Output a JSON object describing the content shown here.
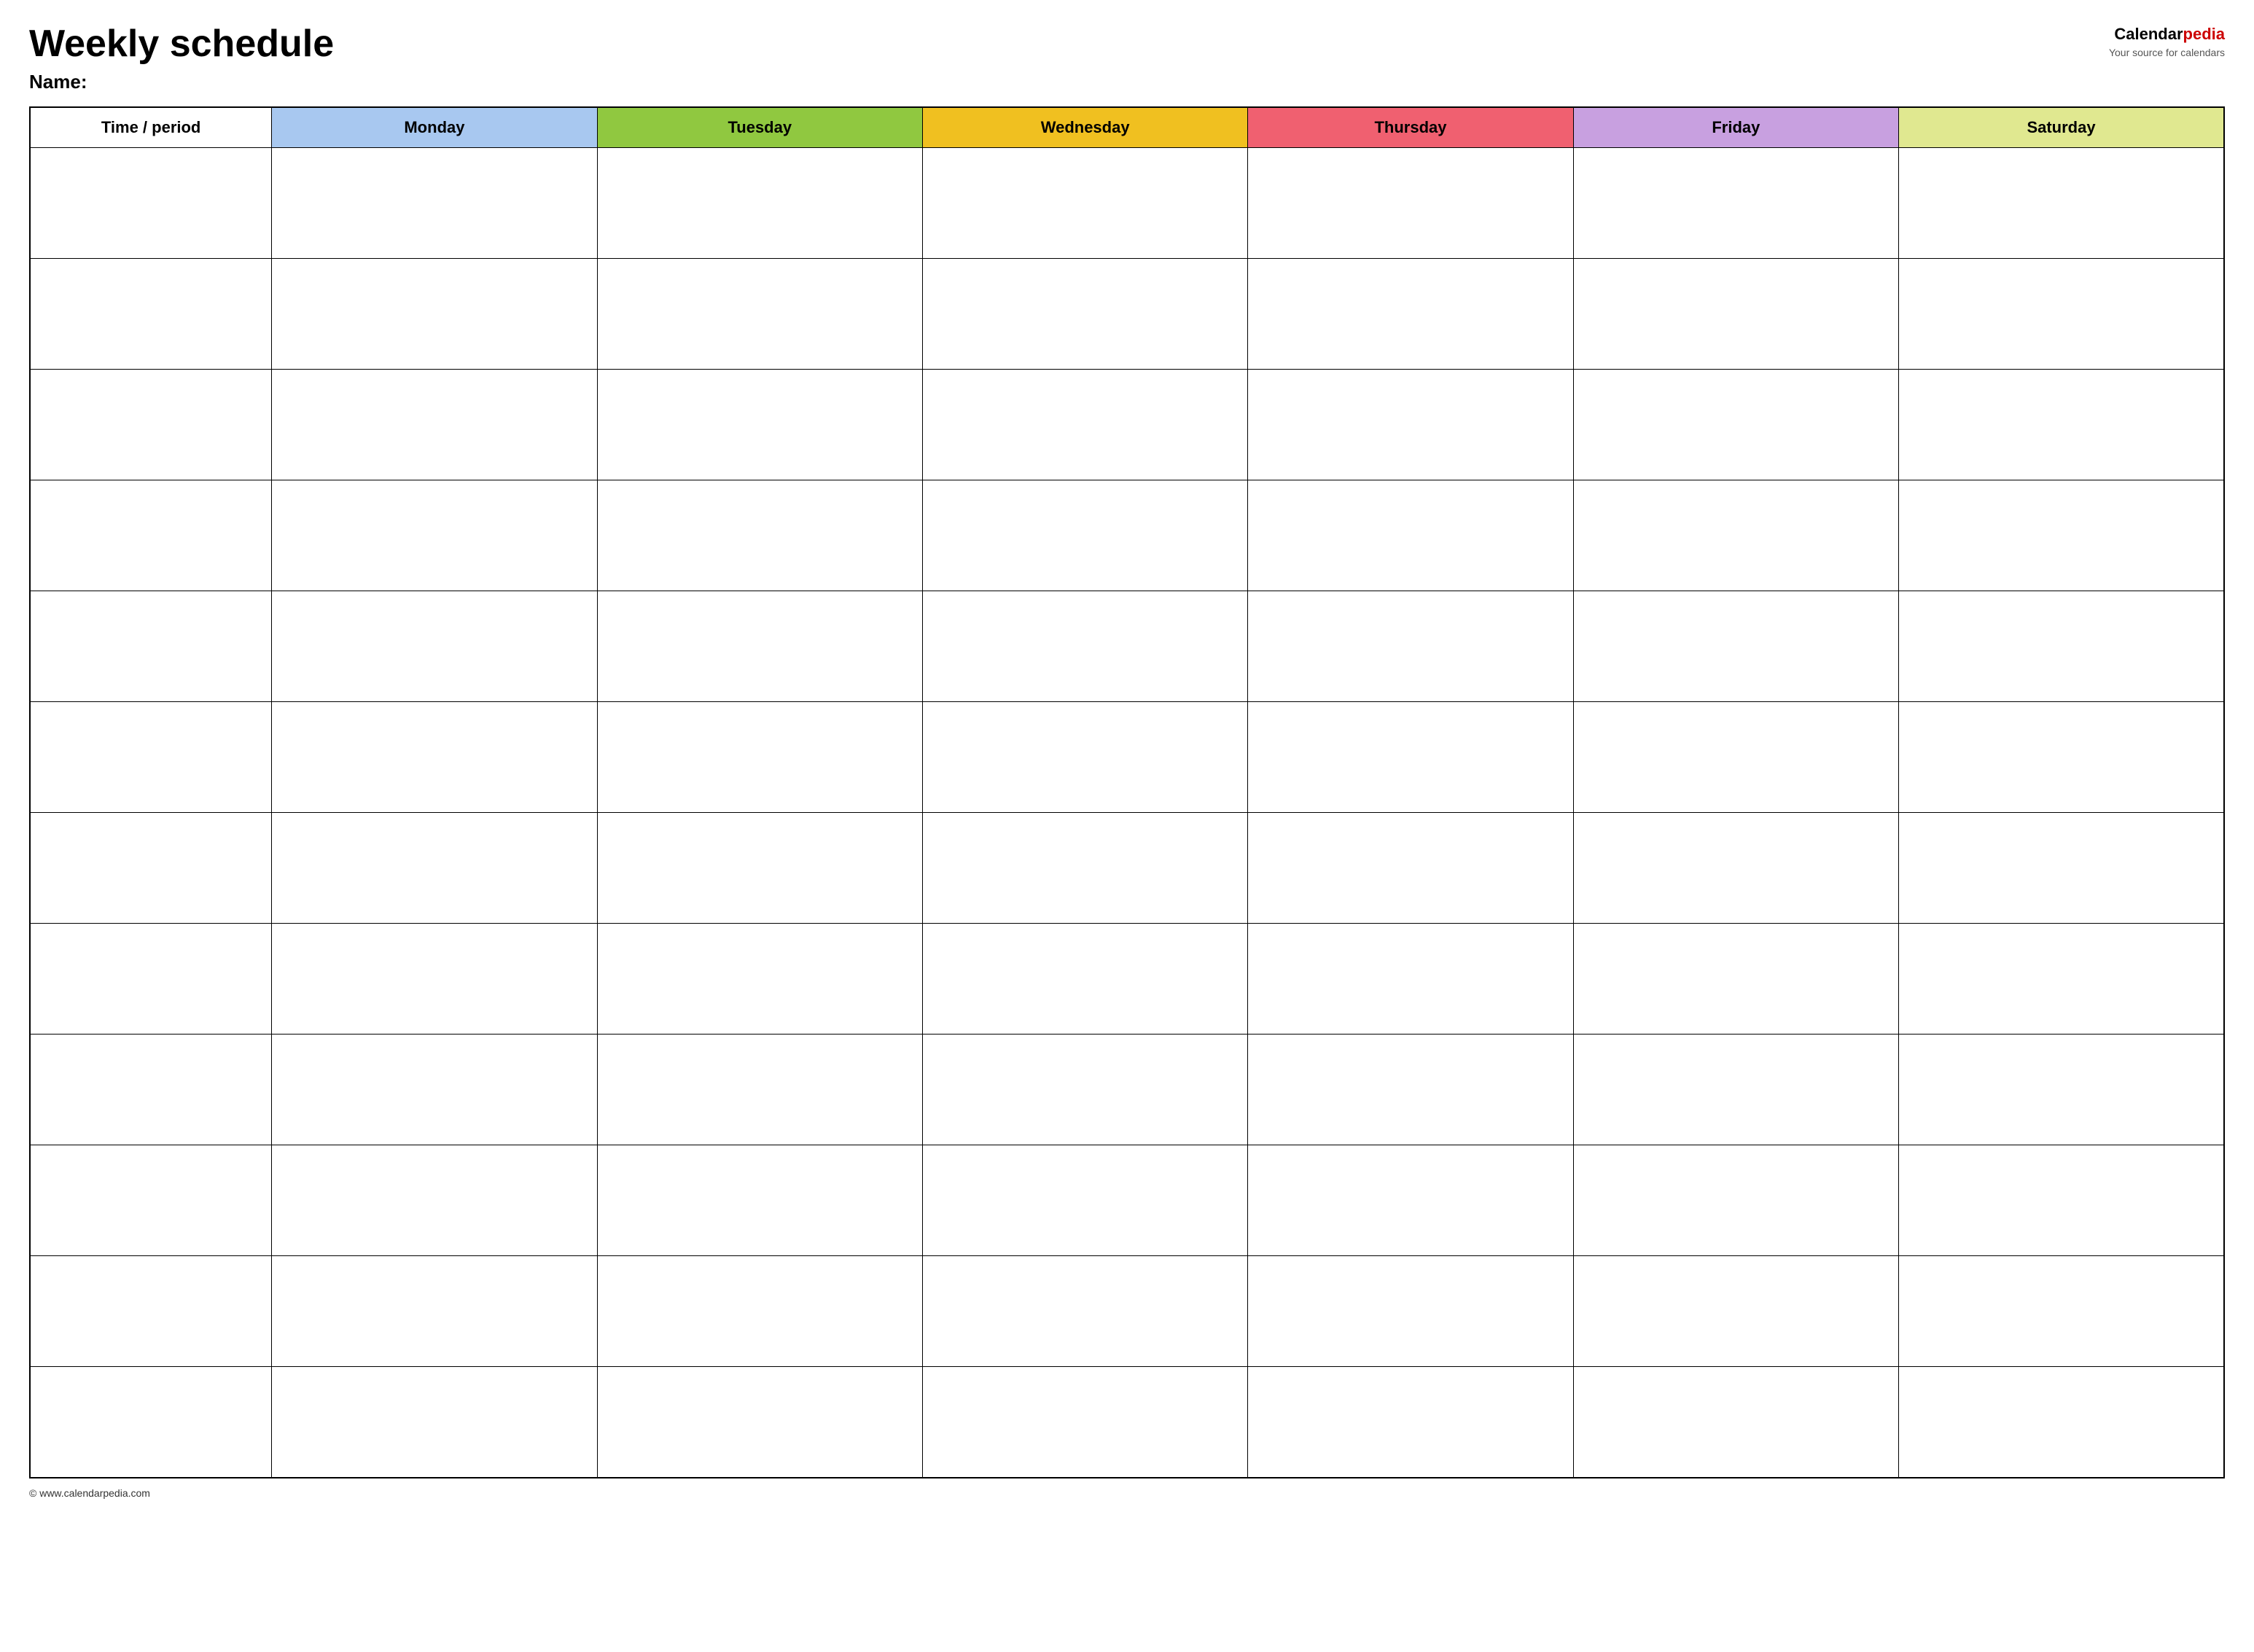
{
  "header": {
    "title": "Weekly schedule",
    "name_label": "Name:",
    "logo_text_black": "Calendar",
    "logo_text_red": "pedia",
    "logo_sub": "Your source for calendars"
  },
  "table": {
    "columns": [
      {
        "id": "time",
        "label": "Time / period",
        "class": "col-time"
      },
      {
        "id": "monday",
        "label": "Monday",
        "class": "col-monday"
      },
      {
        "id": "tuesday",
        "label": "Tuesday",
        "class": "col-tuesday"
      },
      {
        "id": "wednesday",
        "label": "Wednesday",
        "class": "col-wednesday"
      },
      {
        "id": "thursday",
        "label": "Thursday",
        "class": "col-thursday"
      },
      {
        "id": "friday",
        "label": "Friday",
        "class": "col-friday"
      },
      {
        "id": "saturday",
        "label": "Saturday",
        "class": "col-saturday"
      }
    ],
    "rows": 12
  },
  "footer": {
    "url": "© www.calendarpedia.com"
  }
}
